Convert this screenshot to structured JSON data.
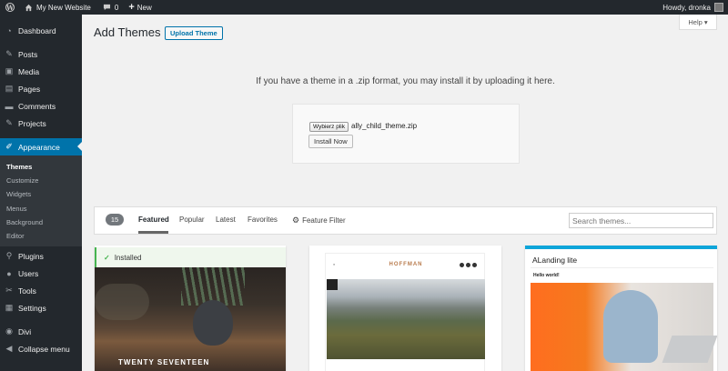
{
  "adminbar": {
    "site_name": "My New Website",
    "comments_count": "0",
    "new_label": "New",
    "greeting": "Howdy, dronka"
  },
  "sidebar": {
    "items": [
      {
        "label": "Dashboard",
        "icon": "dashboard-icon"
      },
      {
        "label": "Posts",
        "icon": "pin-icon"
      },
      {
        "label": "Media",
        "icon": "media-icon"
      },
      {
        "label": "Pages",
        "icon": "page-icon"
      },
      {
        "label": "Comments",
        "icon": "comment-icon"
      },
      {
        "label": "Projects",
        "icon": "pin-icon"
      },
      {
        "label": "Appearance",
        "icon": "brush-icon"
      },
      {
        "label": "Plugins",
        "icon": "plugin-icon"
      },
      {
        "label": "Users",
        "icon": "user-icon"
      },
      {
        "label": "Tools",
        "icon": "wrench-icon"
      },
      {
        "label": "Settings",
        "icon": "settings-icon"
      },
      {
        "label": "Divi",
        "icon": "divi-icon"
      },
      {
        "label": "Collapse menu",
        "icon": "collapse-icon"
      }
    ],
    "submenu": [
      "Themes",
      "Customize",
      "Widgets",
      "Menus",
      "Background",
      "Editor"
    ]
  },
  "header": {
    "title": "Add Themes",
    "upload_label": "Upload Theme",
    "help_label": "Help ▾"
  },
  "upload": {
    "message": "If you have a theme in a .zip format, you may install it by uploading it here.",
    "choose_file_label": "Wybierz plik",
    "file_name": "ally_child_theme.zip",
    "install_label": "Install Now"
  },
  "filter": {
    "count": "15",
    "tabs": [
      "Featured",
      "Popular",
      "Latest",
      "Favorites"
    ],
    "feature_filter_label": "Feature Filter",
    "search_placeholder": "Search themes..."
  },
  "themes": {
    "card1": {
      "status": "Installed",
      "screenshot_title": "TWENTY SEVENTEEN"
    },
    "card2": {
      "title": "HOFFMAN"
    },
    "card3": {
      "title": "ALanding lite",
      "hello": "Hello world!"
    }
  },
  "colors": {
    "admin_dark": "#23282d",
    "accent": "#0073aa",
    "installed_green": "#46b450",
    "landing_blue": "#0ea5d9"
  }
}
